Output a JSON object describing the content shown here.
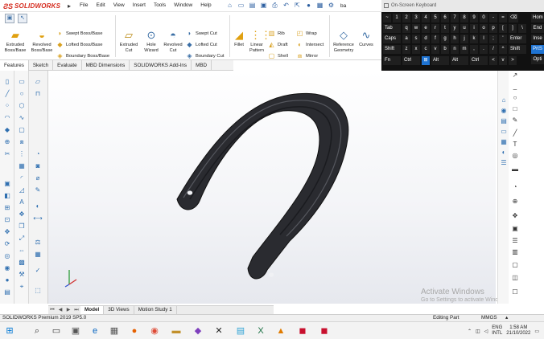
{
  "app": {
    "title_logo": "SOLIDWORKS",
    "menus": [
      "File",
      "Edit",
      "View",
      "Insert",
      "Tools",
      "Window",
      "Help"
    ],
    "doc_label": "ba"
  },
  "ribbon": {
    "big": [
      {
        "id": "extruded-boss",
        "label": "Extruded Boss/Base"
      },
      {
        "id": "revolved-boss",
        "label": "Revolved Boss/Base"
      },
      {
        "id": "extruded-cut",
        "label": "Extruded Cut"
      },
      {
        "id": "hole-wizard",
        "label": "Hole Wizard"
      },
      {
        "id": "revolved-cut",
        "label": "Revolved Cut"
      },
      {
        "id": "fillet",
        "label": "Fillet"
      },
      {
        "id": "linear-pattern",
        "label": "Linear Pattern"
      },
      {
        "id": "reference-geometry",
        "label": "Reference Geometry"
      },
      {
        "id": "curves",
        "label": "Curves"
      }
    ],
    "small": [
      {
        "id": "swept-boss",
        "label": "Swept Boss/Base"
      },
      {
        "id": "lofted-boss",
        "label": "Lofted Boss/Base"
      },
      {
        "id": "boundary-boss",
        "label": "Boundary Boss/Base"
      },
      {
        "id": "swept-cut",
        "label": "Swept Cut"
      },
      {
        "id": "lofted-cut",
        "label": "Lofted Cut"
      },
      {
        "id": "boundary-cut",
        "label": "Boundary Cut"
      },
      {
        "id": "rib",
        "label": "Rib"
      },
      {
        "id": "draft",
        "label": "Draft"
      },
      {
        "id": "shell",
        "label": "Shell"
      },
      {
        "id": "wrap",
        "label": "Wrap"
      },
      {
        "id": "intersect",
        "label": "Intersect"
      },
      {
        "id": "mirror",
        "label": "Mirror"
      }
    ]
  },
  "tabs": [
    "Features",
    "Sketch",
    "Evaluate",
    "MBD Dimensions",
    "SOLIDWORKS Add-Ins",
    "MBD"
  ],
  "osk": {
    "title": "On-Screen Keyboard",
    "rows": [
      [
        "~",
        "1",
        "2",
        "3",
        "4",
        "5",
        "6",
        "7",
        "8",
        "9",
        "0",
        "-",
        "=",
        "⌫"
      ],
      [
        "Tab",
        "q",
        "w",
        "e",
        "r",
        "t",
        "y",
        "u",
        "i",
        "o",
        "p",
        "[",
        "]",
        "\\"
      ],
      [
        "Caps",
        "a",
        "s",
        "d",
        "f",
        "g",
        "h",
        "j",
        "k",
        "l",
        ";",
        "'",
        "Enter"
      ],
      [
        "Shift",
        "z",
        "x",
        "c",
        "v",
        "b",
        "n",
        "m",
        ",",
        ".",
        "/",
        "^",
        "Shift"
      ],
      [
        "Fn",
        "Ctrl",
        "⊞",
        "Alt",
        "Alt",
        "Ctrl",
        "<",
        "v",
        ">"
      ]
    ],
    "side": [
      "Hom",
      "End",
      "Inse",
      "PrtS",
      "Opti"
    ],
    "side2": [
      "Del"
    ]
  },
  "bottom_tabs": [
    "Model",
    "3D Views",
    "Motion Study 1"
  ],
  "status": {
    "left": "SOLIDWORKS Premium 2019 SP5.0",
    "mid": "Editing Part",
    "units": "MMGS"
  },
  "activate": {
    "line1": "Activate Windows",
    "line2": "Go to Settings to activate Windows."
  },
  "taskbar": {
    "lang1": "ENG",
    "lang2": "INTL",
    "time": "1:58 AM",
    "date": "21/10/2022"
  },
  "colors": {
    "model": "#2a2b30",
    "ribbon_bg": "#ffffff",
    "osk_bg": "#111111",
    "osk_key": "#1f1f1f",
    "osk_blue": "#1e73d2"
  }
}
